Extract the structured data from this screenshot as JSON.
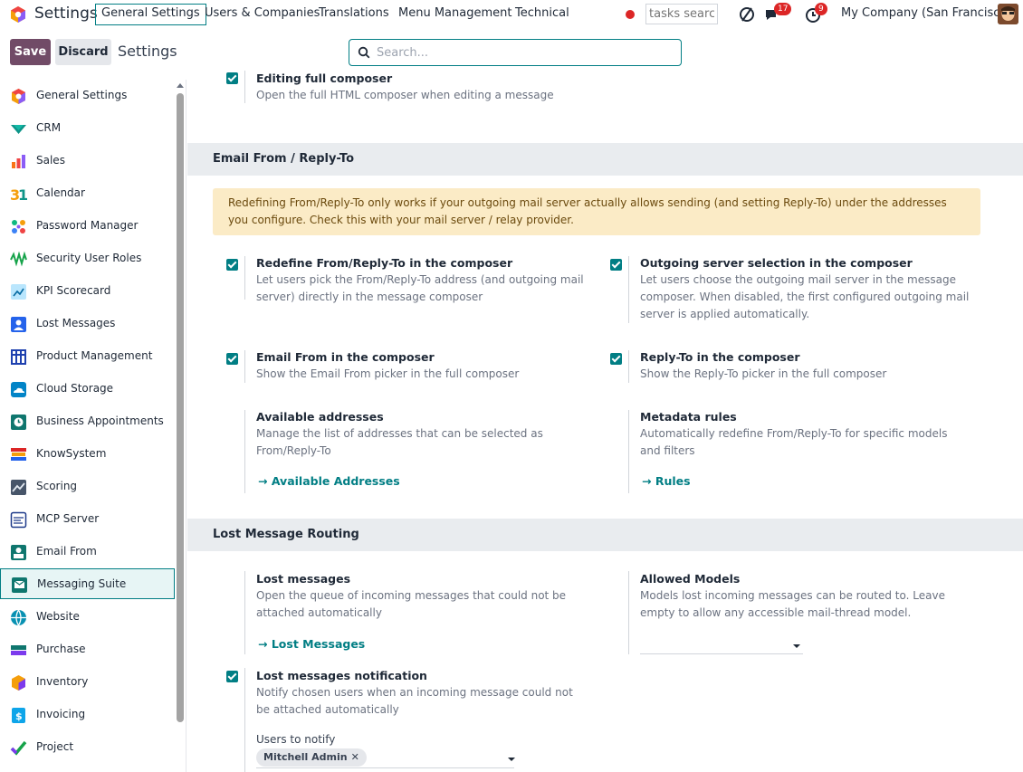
{
  "topbar": {
    "app_title": "Settings",
    "menus": [
      "General Settings",
      "Users & Companies",
      "Translations",
      "Menu Management",
      "Technical"
    ],
    "tasks_search": "tasks search",
    "messages_badge": "17",
    "activities_badge": "9",
    "company": "My Company (San Francisco)"
  },
  "control": {
    "save_label": "Save",
    "discard_label": "Discard",
    "breadcrumb": "Settings",
    "search_placeholder": "Search..."
  },
  "sidebar": {
    "items": [
      {
        "label": "General Settings",
        "icon": "odoo-logo-icon"
      },
      {
        "label": "CRM",
        "icon": "crm-icon"
      },
      {
        "label": "Sales",
        "icon": "sales-icon"
      },
      {
        "label": "Calendar",
        "icon": "calendar-icon"
      },
      {
        "label": "Password Manager",
        "icon": "password-manager-icon"
      },
      {
        "label": "Security User Roles",
        "icon": "security-roles-icon"
      },
      {
        "label": "KPI Scorecard",
        "icon": "kpi-icon"
      },
      {
        "label": "Lost Messages",
        "icon": "lost-messages-icon"
      },
      {
        "label": "Product Management",
        "icon": "product-management-icon"
      },
      {
        "label": "Cloud Storage",
        "icon": "cloud-storage-icon"
      },
      {
        "label": "Business Appointments",
        "icon": "appointments-icon"
      },
      {
        "label": "KnowSystem",
        "icon": "knowsystem-icon"
      },
      {
        "label": "Scoring",
        "icon": "scoring-icon"
      },
      {
        "label": "MCP Server",
        "icon": "mcp-server-icon"
      },
      {
        "label": "Email From",
        "icon": "email-from-icon"
      },
      {
        "label": "Messaging Suite",
        "icon": "messaging-suite-icon"
      },
      {
        "label": "Website",
        "icon": "website-icon"
      },
      {
        "label": "Purchase",
        "icon": "purchase-icon"
      },
      {
        "label": "Inventory",
        "icon": "inventory-icon"
      },
      {
        "label": "Invoicing",
        "icon": "invoicing-icon"
      },
      {
        "label": "Project",
        "icon": "project-icon"
      }
    ],
    "active": "Messaging Suite"
  },
  "main": {
    "partial_setting": {
      "title": "Editing full composer",
      "desc": "Open the full HTML composer when editing a message"
    },
    "section_email": {
      "title": "Email From / Reply-To",
      "alert": "Redefining From/Reply-To only works if your outgoing mail server actually allows sending (and setting Reply-To) under the addresses you configure. Check this with your mail server / relay provider.",
      "redefine": {
        "title": "Redefine From/Reply-To in the composer",
        "desc": "Let users pick the From/Reply-To address (and outgoing mail server) directly in the message composer"
      },
      "outgoing": {
        "title": "Outgoing server selection in the composer",
        "desc": "Let users choose the outgoing mail server in the message composer. When disabled, the first configured outgoing mail server is applied automatically."
      },
      "email_from": {
        "title": "Email From in the composer",
        "desc": "Show the Email From picker in the full composer"
      },
      "reply_to": {
        "title": "Reply-To in the composer",
        "desc": "Show the Reply-To picker in the full composer"
      },
      "addresses": {
        "title": "Available addresses",
        "desc": "Manage the list of addresses that can be selected as From/Reply-To",
        "link": "→ Available Addresses"
      },
      "metadata": {
        "title": "Metadata rules",
        "desc": "Automatically redefine From/Reply-To for specific models and filters",
        "link": "→ Rules"
      }
    },
    "section_lost": {
      "title": "Lost Message Routing",
      "lost": {
        "title": "Lost messages",
        "desc": "Open the queue of incoming messages that could not be attached automatically",
        "link": "→ Lost Messages"
      },
      "allowed": {
        "title": "Allowed Models",
        "desc": "Models lost incoming messages can be routed to. Leave empty to allow any accessible mail-thread model.",
        "value": ""
      },
      "notification": {
        "title": "Lost messages notification",
        "desc": "Notify chosen users when an incoming message could not be attached automatically"
      },
      "users": {
        "label": "Users to notify",
        "tag": "Mitchell Admin",
        "tag_remove": "✕"
      }
    }
  },
  "colors": {
    "primary": "#714b67",
    "accent": "#017e84",
    "alert_bg": "#fbebc6",
    "badge": "#dc2626"
  }
}
